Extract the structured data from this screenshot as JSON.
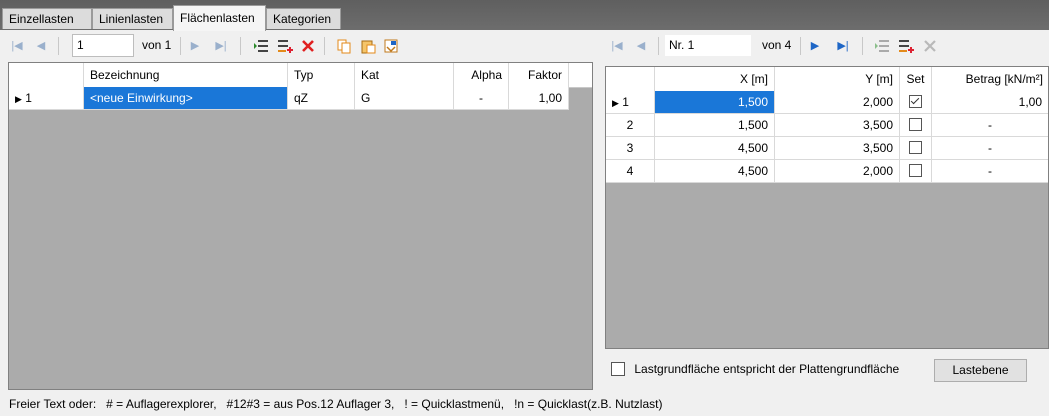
{
  "tabs": [
    "Einzellasten",
    "Linienlasten",
    "Flächenlasten",
    "Kategorien"
  ],
  "left_nav": {
    "position": "1",
    "of": "von 1"
  },
  "right_nav": {
    "position": "Nr. 1",
    "of": "von 4"
  },
  "left_table": {
    "columns": [
      "",
      "Bezeichnung",
      "Typ",
      "Kat",
      "Alpha",
      "Faktor"
    ],
    "rows": [
      {
        "idx": "1",
        "bezeichnung": "<neue Einwirkung>",
        "typ": "qZ",
        "kat": "G",
        "alpha": "-",
        "faktor": "1,00"
      }
    ]
  },
  "right_table": {
    "columns": [
      "",
      "X [m]",
      "Y [m]",
      "Set",
      "Betrag [kN/m²]"
    ],
    "rows": [
      {
        "idx": "1",
        "x": "1,500",
        "y": "2,000",
        "set": true,
        "betrag": "1,00"
      },
      {
        "idx": "2",
        "x": "1,500",
        "y": "3,500",
        "set": false,
        "betrag": "-"
      },
      {
        "idx": "3",
        "x": "4,500",
        "y": "3,500",
        "set": false,
        "betrag": "-"
      },
      {
        "idx": "4",
        "x": "4,500",
        "y": "2,000",
        "set": false,
        "betrag": "-"
      }
    ]
  },
  "checkbox_label": "Lastgrundfläche entspricht der Plattengrundfläche",
  "lastebene_label": "Lastebene",
  "status_text": "Freier Text oder:   # = Auflagerexplorer,   #12#3 = aus Pos.12 Auflager 3,   ! = Quicklastmenü,   !n = Quicklast(z.B. Nutzlast)",
  "colors": {
    "selection": "#1a77d8",
    "grid_bg": "#ababab",
    "delete_red": "#e02020",
    "nav_blue": "#1e66c6"
  }
}
